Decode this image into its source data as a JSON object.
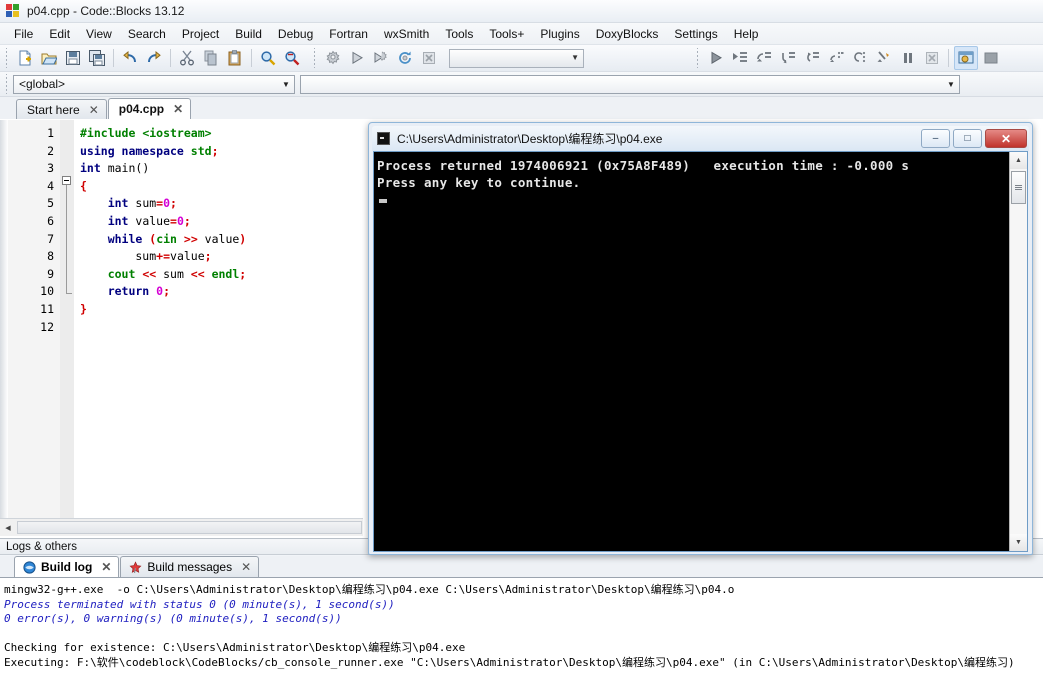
{
  "window": {
    "title": "p04.cpp - Code::Blocks 13.12",
    "logo_icon": "codeblocks-logo-icon"
  },
  "menubar": {
    "items": [
      {
        "label": "File"
      },
      {
        "label": "Edit"
      },
      {
        "label": "View"
      },
      {
        "label": "Search"
      },
      {
        "label": "Project"
      },
      {
        "label": "Build"
      },
      {
        "label": "Debug"
      },
      {
        "label": "Fortran"
      },
      {
        "label": "wxSmith"
      },
      {
        "label": "Tools"
      },
      {
        "label": "Tools+"
      },
      {
        "label": "Plugins"
      },
      {
        "label": "DoxyBlocks"
      },
      {
        "label": "Settings"
      },
      {
        "label": "Help"
      }
    ]
  },
  "toolbar": {
    "main_icons": [
      "new-file-icon",
      "open-file-icon",
      "save-icon",
      "save-all-icon",
      "undo-icon",
      "redo-icon",
      "cut-icon",
      "copy-icon",
      "paste-icon",
      "find-icon",
      "replace-icon"
    ],
    "build_icons": [
      "build-icon",
      "run-icon",
      "build-and-run-icon",
      "rebuild-icon",
      "abort-icon"
    ],
    "debug_icons": [
      "debug-continue-icon",
      "run-to-cursor-icon",
      "next-line-icon",
      "step-into-icon",
      "step-out-icon",
      "next-instruction-icon",
      "step-into-instruction-icon",
      "break-debugger-icon",
      "stop-debugger-icon",
      "debugging-windows-icon",
      "various-info-icon"
    ],
    "target_combo_value": "",
    "target_combo_arrow": "▼"
  },
  "scopebar": {
    "scope_value": "<global>",
    "scope_arrow": "▼",
    "function_value": "",
    "function_arrow": "▼"
  },
  "editor": {
    "tabs": [
      {
        "label": "Start here",
        "active": false,
        "close": "✕"
      },
      {
        "label": "p04.cpp",
        "active": true,
        "close": "✕"
      }
    ],
    "line_numbers": [
      "1",
      "2",
      "3",
      "4",
      "5",
      "6",
      "7",
      "8",
      "9",
      "10",
      "11",
      "12"
    ],
    "code_lines": [
      [
        {
          "t": "#include ",
          "c": "k-pre"
        },
        {
          "t": "<iostream>",
          "c": "k-pre"
        }
      ],
      [
        {
          "t": "using namespace ",
          "c": "k-kw"
        },
        {
          "t": "std",
          "c": "k-pre"
        },
        {
          "t": ";",
          "c": "k-op"
        }
      ],
      [
        {
          "t": "int ",
          "c": "k-type"
        },
        {
          "t": "main",
          "c": "k-plain"
        },
        {
          "t": "()",
          "c": "k-plain"
        }
      ],
      [
        {
          "t": "{",
          "c": "k-brace"
        }
      ],
      [
        {
          "t": "    int ",
          "c": "k-type"
        },
        {
          "t": "sum",
          "c": "k-plain"
        },
        {
          "t": "=",
          "c": "k-op"
        },
        {
          "t": "0",
          "c": "k-num"
        },
        {
          "t": ";",
          "c": "k-op"
        }
      ],
      [
        {
          "t": "    int ",
          "c": "k-type"
        },
        {
          "t": "value",
          "c": "k-plain"
        },
        {
          "t": "=",
          "c": "k-op"
        },
        {
          "t": "0",
          "c": "k-num"
        },
        {
          "t": ";",
          "c": "k-op"
        }
      ],
      [
        {
          "t": "    while ",
          "c": "k-kw"
        },
        {
          "t": "(",
          "c": "k-op"
        },
        {
          "t": "cin",
          "c": "k-pre"
        },
        {
          "t": " >> ",
          "c": "k-op"
        },
        {
          "t": "value",
          "c": "k-plain"
        },
        {
          "t": ")",
          "c": "k-op"
        }
      ],
      [
        {
          "t": "        sum",
          "c": "k-plain"
        },
        {
          "t": "+=",
          "c": "k-op"
        },
        {
          "t": "value",
          "c": "k-plain"
        },
        {
          "t": ";",
          "c": "k-op"
        }
      ],
      [
        {
          "t": "    cout",
          "c": "k-pre"
        },
        {
          "t": " << ",
          "c": "k-op"
        },
        {
          "t": "sum",
          "c": "k-plain"
        },
        {
          "t": " << ",
          "c": "k-op"
        },
        {
          "t": "endl",
          "c": "k-pre"
        },
        {
          "t": ";",
          "c": "k-op"
        }
      ],
      [
        {
          "t": "    return ",
          "c": "k-kw"
        },
        {
          "t": "0",
          "c": "k-num"
        },
        {
          "t": ";",
          "c": "k-op"
        }
      ],
      [
        {
          "t": "}",
          "c": "k-brace"
        }
      ],
      []
    ]
  },
  "logs": {
    "panel_title": "Logs & others",
    "tabs": [
      {
        "label": "Build log",
        "icon": "build-log-icon",
        "active": true,
        "close": "✕"
      },
      {
        "label": "Build messages",
        "icon": "build-messages-icon",
        "active": false,
        "close": "✕"
      }
    ],
    "lines": [
      {
        "text": "mingw32-g++.exe  -o C:\\Users\\Administrator\\Desktop\\编程练习\\p04.exe C:\\Users\\Administrator\\Desktop\\编程练习\\p04.o",
        "style": "black"
      },
      {
        "text": "Process terminated with status 0 (0 minute(s), 1 second(s))",
        "style": "blue"
      },
      {
        "text": "0 error(s), 0 warning(s) (0 minute(s), 1 second(s))",
        "style": "blue"
      },
      {
        "text": "",
        "style": "spacer"
      },
      {
        "text": "Checking for existence: C:\\Users\\Administrator\\Desktop\\编程练习\\p04.exe",
        "style": "black"
      },
      {
        "text": "Executing: F:\\软件\\codeblock\\CodeBlocks/cb_console_runner.exe \"C:\\Users\\Administrator\\Desktop\\编程练习\\p04.exe\" (in C:\\Users\\Administrator\\Desktop\\编程练习)",
        "style": "black"
      }
    ]
  },
  "console": {
    "title": "C:\\Users\\Administrator\\Desktop\\编程练习\\p04.exe",
    "icon": "console-app-icon",
    "buttons": {
      "minimize": "–",
      "maximize": "□",
      "close": "✕"
    },
    "output_lines": [
      "Process returned 1974006921 (0x75A8F489)   execution time : -0.000 s",
      "Press any key to continue."
    ],
    "scroll": {
      "up": "▲",
      "down": "▼"
    }
  },
  "colors": {
    "console_bg": "#000000",
    "console_fg": "#e6e6e6",
    "log_blue": "#2020c0",
    "keyword": "#00007f",
    "preproc": "#008000",
    "operator": "#d00000",
    "number": "#d400d4",
    "close_button": "#c0332c"
  }
}
